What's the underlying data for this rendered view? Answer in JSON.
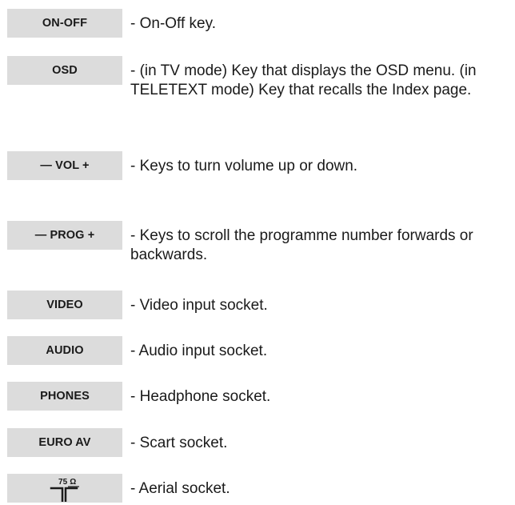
{
  "items": [
    {
      "key": "ON-OFF",
      "description": "- On-Off key."
    },
    {
      "key": "OSD",
      "description": "- (in TV mode) Key that displays the OSD menu. (in TELETEXT mode) Key that recalls the Index page."
    },
    {
      "key": "— VOL +",
      "description": "- Keys to turn volume up or down."
    },
    {
      "key": "— PROG +",
      "description": "- Keys to scroll the programme number forwards or backwards."
    },
    {
      "key": "VIDEO",
      "description": "- Video input socket."
    },
    {
      "key": "AUDIO",
      "description": "- Audio input socket."
    },
    {
      "key": "PHONES",
      "description": "- Headphone socket."
    },
    {
      "key": "EURO AV",
      "description": "- Scart socket."
    },
    {
      "key_icon": "aerial-socket-icon",
      "key_icon_label": "75 Ω",
      "description": "- Aerial socket."
    }
  ]
}
